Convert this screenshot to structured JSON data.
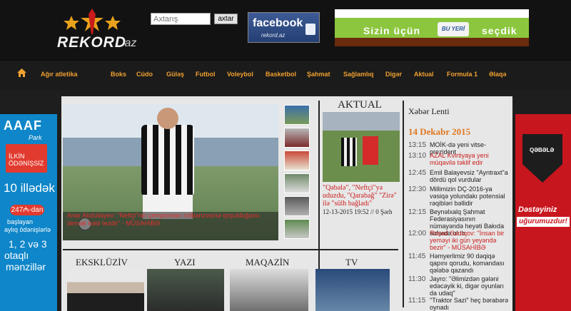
{
  "header": {
    "logo_text": "REKORD",
    "logo_tld": ".az",
    "search": {
      "placeholder": "Axtarış",
      "button_label": "axtar"
    },
    "facebook": {
      "title": "facebook",
      "subtitle": "rekord.az"
    },
    "ad": {
      "left_text": "Sizin üçün",
      "sign_text": "BU YERİ",
      "right_text": "seçdik"
    }
  },
  "nav": {
    "items": [
      "Ağır atletika",
      "Boks",
      "Cüdo",
      "Güləş",
      "Futbol",
      "Voleybol",
      "Basketbol",
      "Şahmat",
      "Sağlamlıq",
      "Digər",
      "Aktual",
      "Formula 1",
      "Əlaqə"
    ]
  },
  "left_ad": {
    "logo": "AAAF",
    "logo_sub": "Park",
    "red_line1": "İLKİN",
    "red_line2": "ÖDƏNİŞSİZ",
    "big": "10 illədək",
    "price": "247₼-dan",
    "small1": "başlayan",
    "small2": "aylıq ödənişlərlə",
    "rooms1": "1, 2 və 3",
    "rooms2": "otaqlı",
    "rooms3": "mənzillər"
  },
  "right_ad": {
    "club": "QƏBƏLƏ",
    "line1": "Dəstəyiniz",
    "line2": "uğurumuzdur!"
  },
  "slider": {
    "caption": "Anar Abdullayev: \"Neftçi\"nin çempionları milbarizəsinə qoşulduğunu demək hələ tezdir\" - MÜSAHİBƏ"
  },
  "aktual": {
    "title": "AKTUAL",
    "headline": "\"Qəbələ\", \"Neftçi\"yə uduzdu, \"Qarabağ\" \"Zirə\" ilə \"sülh bağladı\"",
    "date": "12-13-2015 19:52",
    "comments": "// 0 Şərh"
  },
  "news_feed": {
    "title": "Xəbər Lenti",
    "date": "14 Dekabr 2015",
    "items": [
      {
        "time": "13:15",
        "text": "MOİK-də yeni vitse-prezident",
        "color": "#222222"
      },
      {
        "time": "13:10",
        "text": "AZAL Kvirtiyaya yeni müqavilə təklif edir",
        "color": "#cc1f1f"
      },
      {
        "time": "12:45",
        "text": "Emil Balayevsiz \"Ayntraxt\"a dördü qol vurdular",
        "color": "#222222"
      },
      {
        "time": "12:30",
        "text": "Millimizin DÇ-2016-ya vəsiqə yolundakı potensial rəqibləri bəllidir",
        "color": "#222222"
      },
      {
        "time": "12:15",
        "text": "Beynəlxalq Şahmat Federasiyasının nümayəndə heyəti Bakıda səfərdə olub",
        "color": "#222222"
      },
      {
        "time": "12:00",
        "text": "Rəşad Sadıqov: \"İnsan bir yeməyi iki gün yeyəndə bezir\" - MÜSAHİBƏ",
        "color": "#cc1f1f"
      },
      {
        "time": "11:45",
        "text": "Həmyerlimiz 90 dəqiqə qapını qorudu, komandası qələbə qazandı",
        "color": "#222222"
      },
      {
        "time": "11:30",
        "text": "Jayro: \"Əlimizdən gələni edəcəyik ki, digər oyunları da udaq\"",
        "color": "#222222"
      },
      {
        "time": "11:15",
        "text": "\"Traktor Sazi\" heç bərabərə oynadı",
        "color": "#222222"
      }
    ]
  },
  "sections": [
    "EKSKLÜZİV",
    "YAZI",
    "MAQAZİN",
    "TV"
  ]
}
